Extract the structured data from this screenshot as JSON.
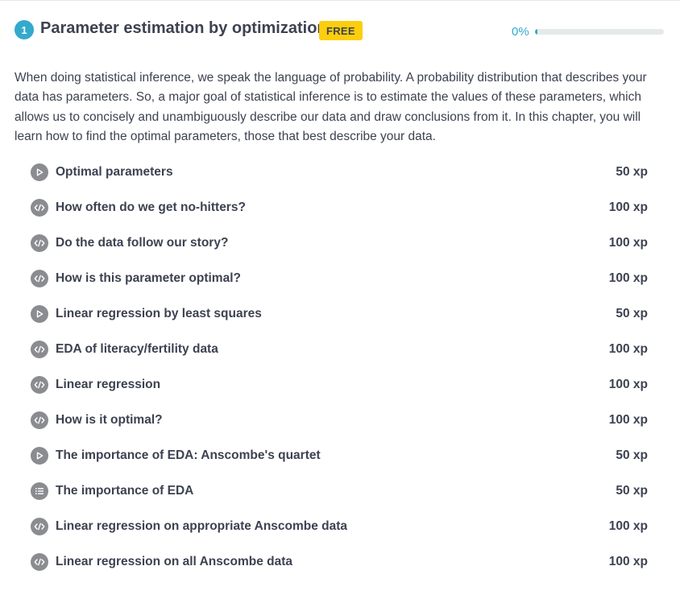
{
  "chapter": {
    "number": "1",
    "title": "Parameter estimation by optimization",
    "badge": "FREE",
    "progress_label": "0%",
    "progress_fraction": 0,
    "description": "When doing statistical inference, we speak the language of probability. A probability distribution that describes your data has parameters. So, a major goal of statistical inference is to estimate the values of these parameters, which allows us to concisely and unambiguously describe our data and draw conclusions from it. In this chapter, you will learn how to find the optimal parameters, those that best describe your data."
  },
  "lessons": [
    {
      "title": "Optimal parameters",
      "xp": "50 xp",
      "icon": "play-icon"
    },
    {
      "title": "How often do we get no-hitters?",
      "xp": "100 xp",
      "icon": "code-icon"
    },
    {
      "title": "Do the data follow our story?",
      "xp": "100 xp",
      "icon": "code-icon"
    },
    {
      "title": "How is this parameter optimal?",
      "xp": "100 xp",
      "icon": "code-icon"
    },
    {
      "title": "Linear regression by least squares",
      "xp": "50 xp",
      "icon": "play-icon"
    },
    {
      "title": "EDA of literacy/fertility data",
      "xp": "100 xp",
      "icon": "code-icon"
    },
    {
      "title": "Linear regression",
      "xp": "100 xp",
      "icon": "code-icon"
    },
    {
      "title": "How is it optimal?",
      "xp": "100 xp",
      "icon": "code-icon"
    },
    {
      "title": "The importance of EDA: Anscombe's quartet",
      "xp": "50 xp",
      "icon": "play-icon"
    },
    {
      "title": "The importance of EDA",
      "xp": "50 xp",
      "icon": "list-icon"
    },
    {
      "title": "Linear regression on appropriate Anscombe data",
      "xp": "100 xp",
      "icon": "code-icon"
    },
    {
      "title": "Linear regression on all Anscombe data",
      "xp": "100 xp",
      "icon": "code-icon"
    }
  ],
  "colors": {
    "accent": "#33aacc",
    "badge": "#fcce0d",
    "icon_bg": "#8a8c90",
    "text": "#3d4251"
  }
}
